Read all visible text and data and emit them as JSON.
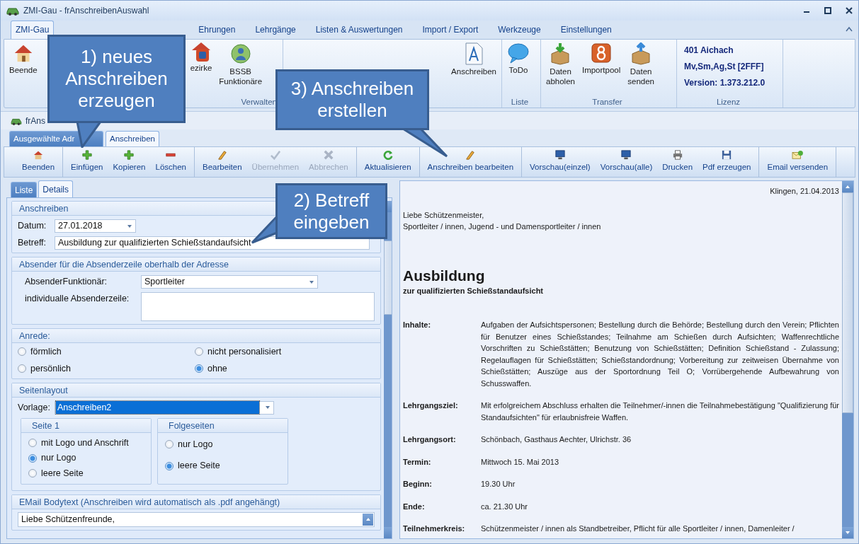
{
  "window": {
    "title": "ZMI-Gau - frAnschreibenAuswahl"
  },
  "ribbon_tabs": [
    {
      "label": "ZMI-Gau",
      "selected": true
    },
    {
      "label": "Ehrungen",
      "selected": false
    },
    {
      "label": "Lehrgänge",
      "selected": false
    },
    {
      "label": "Listen & Auswertungen",
      "selected": false
    },
    {
      "label": "Import / Export",
      "selected": false
    },
    {
      "label": "Werkzeuge",
      "selected": false
    },
    {
      "label": "Einstellungen",
      "selected": false
    }
  ],
  "ribbon_groups": [
    {
      "label": "Verwalten",
      "items": [
        {
          "label": "Beende"
        },
        {
          "label": "ezirke"
        },
        {
          "label": "BSSB\nFunktionäre"
        }
      ]
    },
    {
      "items": [
        {
          "label": "Anschreiben"
        }
      ]
    },
    {
      "label": "Liste",
      "items": [
        {
          "label": "ToDo"
        }
      ]
    },
    {
      "label": "Transfer",
      "items": [
        {
          "label": "Daten\nabholen"
        },
        {
          "label": "Importpool"
        },
        {
          "label": "Daten\nsenden"
        }
      ]
    }
  ],
  "license": {
    "label": "Lizenz",
    "lines": [
      "401 Aichach",
      "Mv,Sm,Ag,St [2FFF]",
      "Version: 1.373.212.0"
    ]
  },
  "document_tab": "frAns",
  "tabs": [
    {
      "label": "Ausgewählte Adr",
      "selected": false
    },
    {
      "label": "Anschreiben",
      "selected": true
    }
  ],
  "toolbar": [
    [
      {
        "label": "Beenden",
        "disabled": false
      }
    ],
    [
      {
        "label": "Einfügen",
        "disabled": false
      },
      {
        "label": "Kopieren",
        "disabled": false
      },
      {
        "label": "Löschen",
        "disabled": false
      }
    ],
    [
      {
        "label": "Bearbeiten",
        "disabled": false
      },
      {
        "label": "Übernehmen",
        "disabled": true
      },
      {
        "label": "Abbrechen",
        "disabled": true
      }
    ],
    [
      {
        "label": "Aktualisieren",
        "disabled": false
      }
    ],
    [
      {
        "label": "Anschreiben bearbeiten",
        "disabled": false
      }
    ],
    [
      {
        "label": "Vorschau(einzel)",
        "disabled": false
      },
      {
        "label": "Vorschau(alle)",
        "disabled": false
      },
      {
        "label": "Drucken",
        "disabled": false
      },
      {
        "label": "Pdf erzeugen",
        "disabled": false
      }
    ],
    [
      {
        "label": "Email versenden",
        "disabled": false
      }
    ]
  ],
  "detail_tabs": [
    {
      "label": "Liste",
      "selected": false
    },
    {
      "label": "Details",
      "selected": true
    }
  ],
  "letter": {
    "title": "Anschreiben",
    "date_label": "Datum:",
    "date": "27.01.2018",
    "subject_label": "Betreff:",
    "subject": "Ausbildung zur qualifizierten Schießstandaufsicht"
  },
  "sender": {
    "title": "Absender für die Absenderzeile oberhalb der Adresse",
    "official_label": "AbsenderFunktionär:",
    "official": "Sportleiter",
    "line_label": "individualle Absenderzeile:"
  },
  "salutation": {
    "title": "Anrede:",
    "options": [
      {
        "label": "förmlich",
        "selected": false
      },
      {
        "label": "nicht personalisiert",
        "selected": false
      },
      {
        "label": "persönlich",
        "selected": false
      },
      {
        "label": "ohne",
        "selected": true
      }
    ]
  },
  "page_layout": {
    "title": "Seitenlayout",
    "template_label": "Vorlage:",
    "template": "Anschreiben2",
    "first_page": {
      "title": "Seite 1",
      "options": [
        {
          "label": "mit Logo und Anschrift",
          "selected": false
        },
        {
          "label": "nur Logo",
          "selected": true
        },
        {
          "label": "leere Seite",
          "selected": false
        }
      ]
    },
    "following_pages": {
      "title": "Folgeseiten",
      "options": [
        {
          "label": "nur Logo",
          "selected": false
        },
        {
          "label": "leere Seite",
          "selected": true
        }
      ]
    }
  },
  "email": {
    "title": "EMail Bodytext (Anschreiben wird automatisch als .pdf angehängt)",
    "body": "Liebe Schützenfreunde,"
  },
  "preview": {
    "place_date": "Klingen, 21.04.2013",
    "greeting": [
      "Liebe Schützenmeister,",
      "Sportleiter / innen, Jugend - und Damensportleiter / innen"
    ],
    "heading": "Ausbildung",
    "subheading": "zur qualifizierten Schießstandaufsicht",
    "rows": [
      {
        "label": "Inhalte:",
        "text": "Aufgaben der Aufsichtspersonen; Bestellung durch die Behörde; Bestellung durch den Verein; Pflichten für Benutzer eines Schießstandes; Teilnahme am Schießen durch Aufsichten; Waffenrechtliche Vorschriften zu Schießstätten; Benutzung von Schießstätten; Definition Schießstand - Zulassung; Regelauflagen für Schießstätten; Schießstandordnung; Vorbereitung zur zeitweisen Übernahme von Schießstätten; Auszüge aus der Sportordnung Teil O; Vorrübergehende Aufbewahrung von Schusswaffen."
      },
      {
        "label": "Lehrgangsziel:",
        "text": "Mit erfolgreichem Abschluss erhalten die Teilnehmer/-innen die Teilnahmebestätigung \"Qualifizierung für Standaufsichten\" für erlaubnisfreie Waffen."
      },
      {
        "label": "Lehrgangsort:",
        "text": "Schönbach, Gasthaus Aechter, Ulrichstr. 36"
      },
      {
        "label": "Termin:",
        "text": "Mittwoch 15. Mai 2013"
      },
      {
        "label": "Beginn:",
        "text": "19.30 Uhr"
      },
      {
        "label": "Ende:",
        "text": "ca. 21.30 Uhr"
      },
      {
        "label": "Teilnehmerkreis:",
        "text": "Schützenmeister / innen als Standbetreiber, Pflicht für alle Sportleiter / innen, Damenleiter /"
      }
    ]
  },
  "callouts": [
    {
      "text": "1) neues Anschreiben erzeugen"
    },
    {
      "text": "3) Anschreiben erstellen"
    },
    {
      "text": "2) Betreff eingeben"
    }
  ]
}
